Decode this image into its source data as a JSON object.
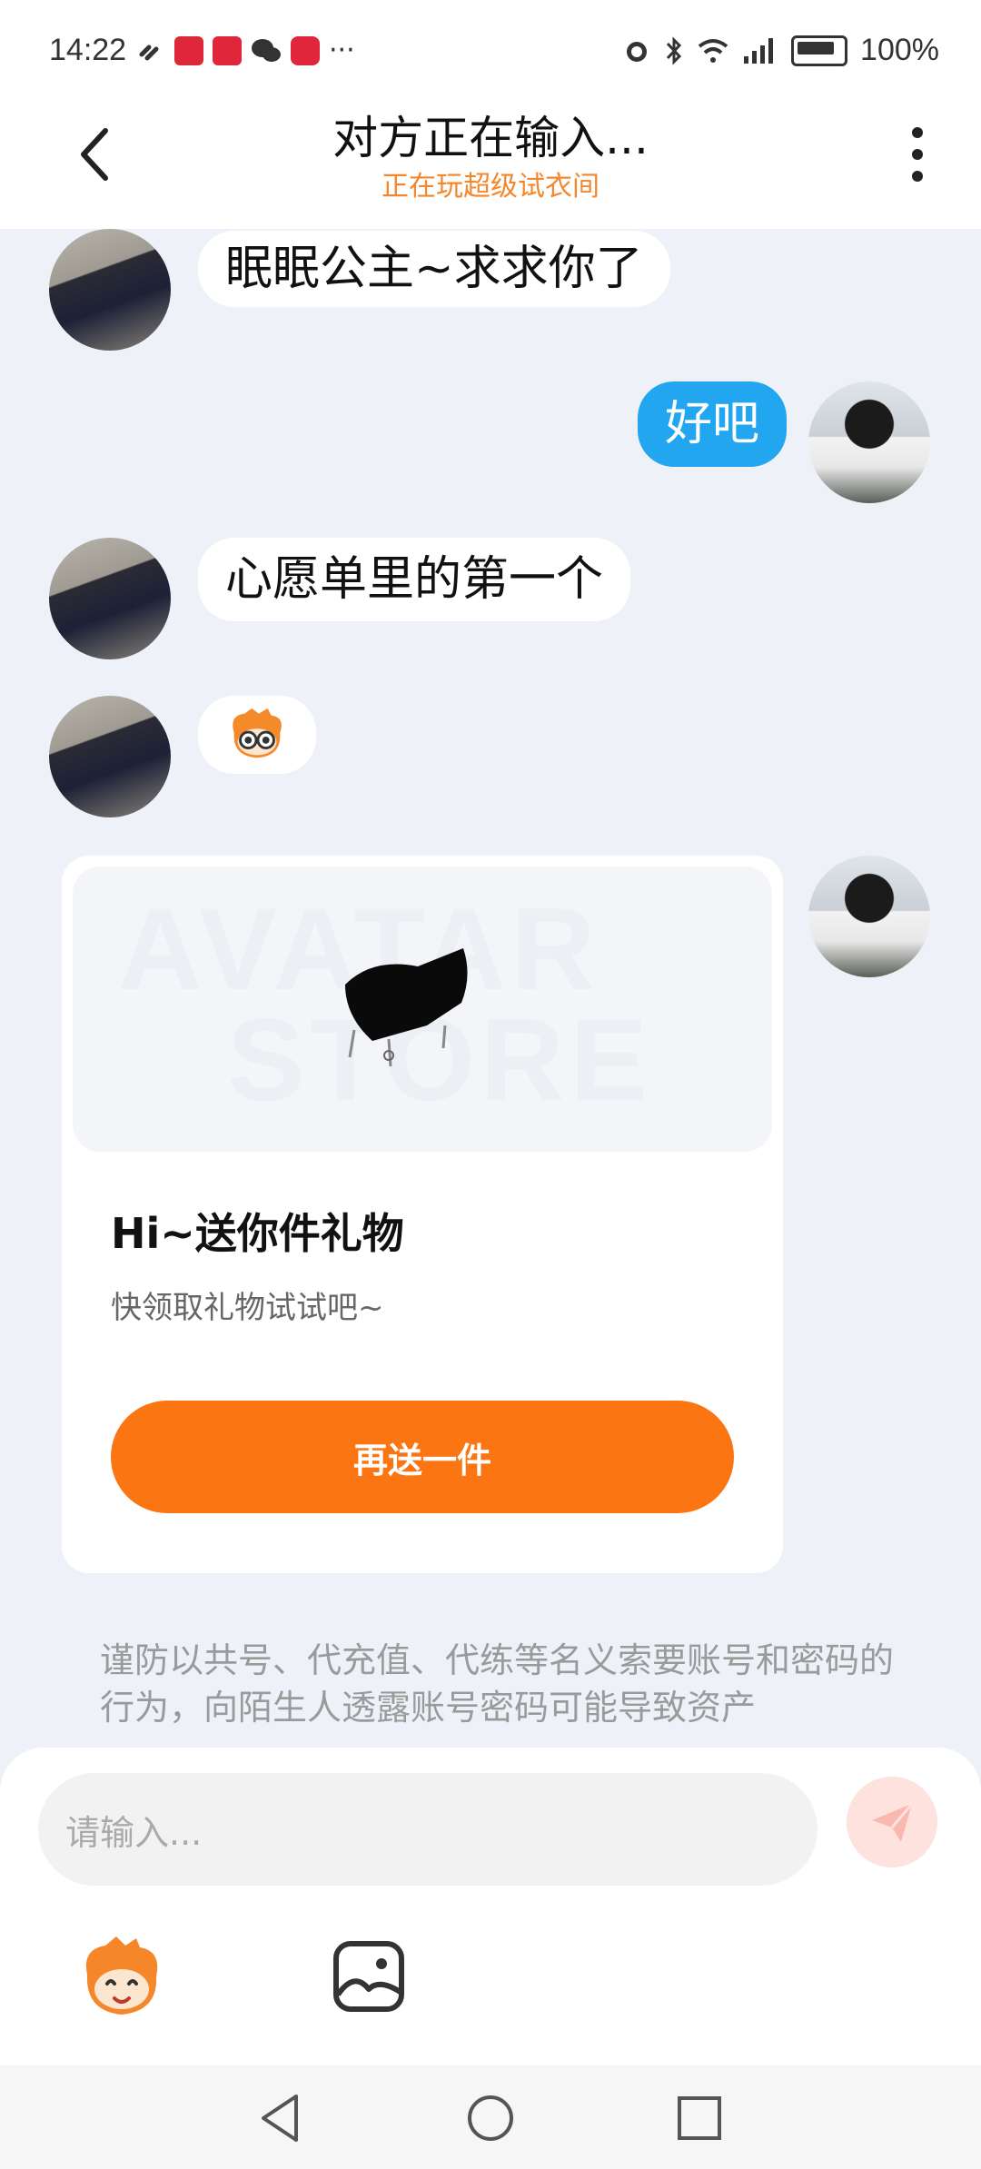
{
  "status": {
    "time": "14:22",
    "more": "···",
    "battery": "100%"
  },
  "header": {
    "title": "对方正在输入...",
    "subtitle": "正在玩超级试衣间"
  },
  "messages": {
    "m1": "眠眠公主~求求你了",
    "m2": "好吧",
    "m3": "心愿单里的第一个"
  },
  "gift_card": {
    "title": "Hi~送你件礼物",
    "subtitle": "快领取礼物试试吧~",
    "button": "再送一件",
    "watermark_top": "AVATAR",
    "watermark_bottom": "STORE"
  },
  "warning": "谨防以共号、代充值、代练等名义索要账号和密码的行为，向陌生人透露账号密码可能导致资产",
  "composer": {
    "placeholder": "请输入..."
  },
  "colors": {
    "accent": "#fb7512",
    "self_bubble": "#23a6f0",
    "subtitle": "#f5862b"
  },
  "icons": [
    "back-icon",
    "more-icon",
    "send-icon",
    "emoji-icon",
    "image-icon",
    "nav-back-icon",
    "nav-home-icon",
    "nav-recent-icon"
  ]
}
